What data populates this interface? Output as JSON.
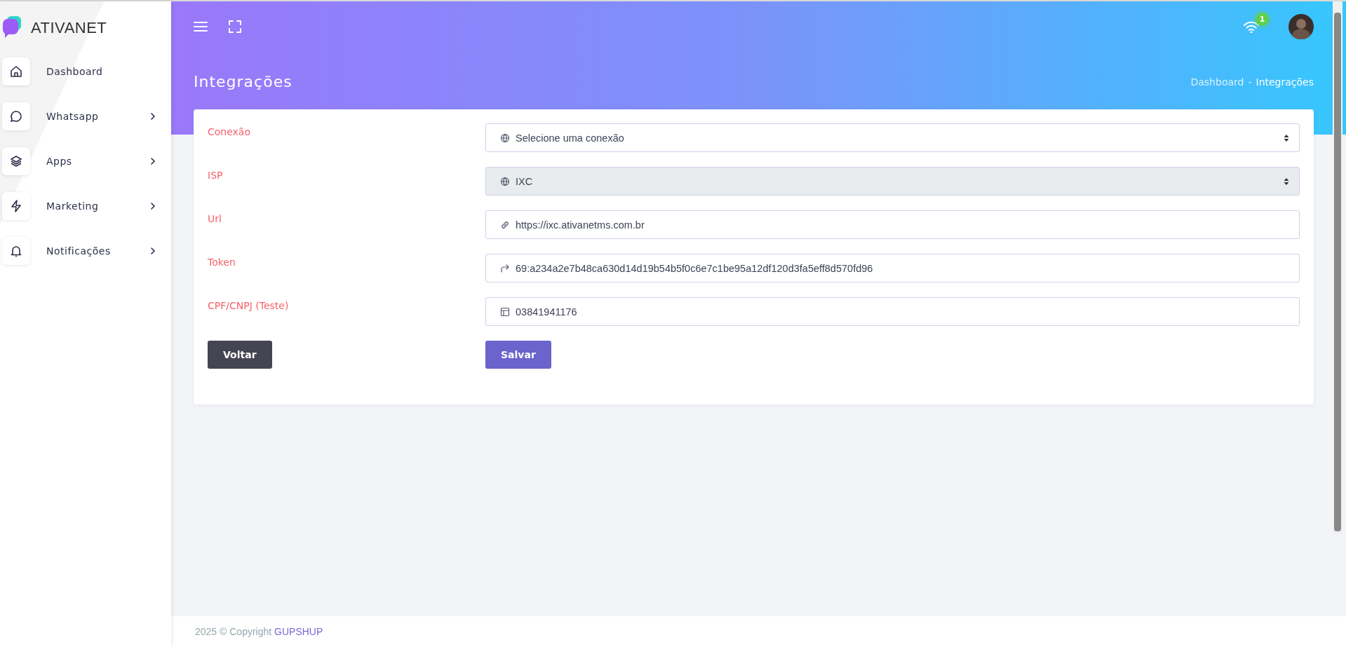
{
  "brand": {
    "name": "ATIVANET"
  },
  "sidebar": {
    "items": [
      {
        "label": "Dashboard",
        "expandable": false
      },
      {
        "label": "Whatsapp",
        "expandable": true
      },
      {
        "label": "Apps",
        "expandable": true
      },
      {
        "label": "Marketing",
        "expandable": true
      },
      {
        "label": "Notificações",
        "expandable": true
      }
    ]
  },
  "topbar": {
    "notification_count": "1"
  },
  "page": {
    "title": "Integrações",
    "breadcrumb_separator": "-",
    "breadcrumb": [
      {
        "label": "Dashboard",
        "current": false
      },
      {
        "label": "Integrações",
        "current": true
      }
    ]
  },
  "form": {
    "fields": [
      {
        "label": "Conexão",
        "kind": "select",
        "value": "Selecione uma conexão",
        "disabled": false
      },
      {
        "label": "ISP",
        "kind": "select",
        "value": "IXC",
        "disabled": true
      },
      {
        "label": "Url",
        "kind": "input",
        "value": "https://ixc.ativanetms.com.br",
        "disabled": false
      },
      {
        "label": "Token",
        "kind": "input",
        "value": "69:a234a2e7b48ca630d14d19b54b5f0c6e7c1be95a12df120d3fa5eff8d570fd96",
        "disabled": false
      },
      {
        "label": "CPF/CNPJ (Teste)",
        "kind": "input",
        "value": "03841941176",
        "disabled": false
      }
    ],
    "buttons": [
      {
        "label": "Voltar",
        "kind": "back"
      },
      {
        "label": "Salvar",
        "kind": "save"
      }
    ]
  },
  "footer": {
    "year": "2025 © Copyright",
    "brand": "GUPSHUP"
  }
}
